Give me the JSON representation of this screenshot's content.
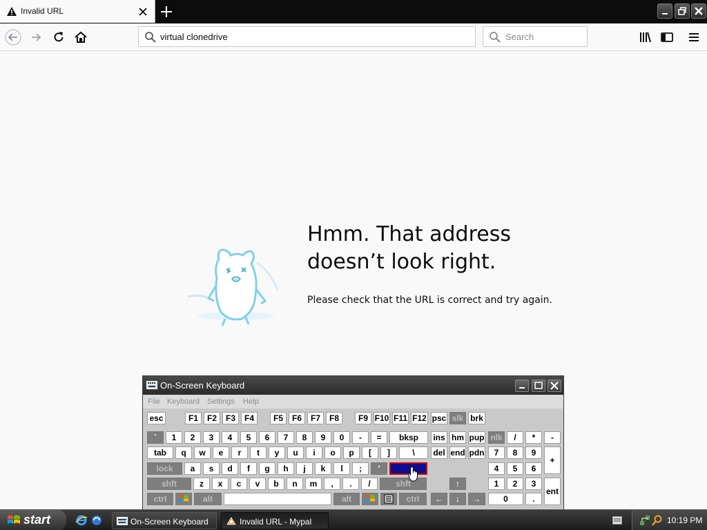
{
  "browser": {
    "tab_title": "Invalid URL",
    "url_value": "virtual clonedrive",
    "search_placeholder": "Search"
  },
  "error_page": {
    "title_line1": "Hmm. That address",
    "title_line2": "doesn’t look right.",
    "description": "Please check that the URL is correct and try again."
  },
  "osk": {
    "title": "On-Screen Keyboard",
    "menu": [
      "File",
      "Keyboard",
      "Settings",
      "Help"
    ],
    "keys": [
      "esc",
      "F1",
      "F2",
      "F3",
      "F4",
      "F5",
      "F6",
      "F7",
      "F8",
      "F9",
      "F10",
      "F11",
      "F12",
      "psc",
      "slk",
      "brk",
      "`",
      "1",
      "2",
      "3",
      "4",
      "5",
      "6",
      "7",
      "8",
      "9",
      "0",
      "-",
      "=",
      "bksp",
      "ins",
      "hm",
      "pup",
      "nlk",
      "/",
      "*",
      "-",
      "tab",
      "q",
      "w",
      "e",
      "r",
      "t",
      "y",
      "u",
      "i",
      "o",
      "p",
      "[",
      "]",
      "\\",
      "del",
      "end",
      "pdn",
      "7",
      "8",
      "9",
      "+",
      "lock",
      "a",
      "s",
      "d",
      "f",
      "g",
      "h",
      "j",
      "k",
      "l",
      ";",
      "'",
      "",
      "4",
      "5",
      "6",
      "shft",
      "z",
      "x",
      "c",
      "v",
      "b",
      "n",
      "m",
      ",",
      ".",
      "/",
      "shft",
      "↑",
      "1",
      "2",
      "3",
      "ent",
      "ctrl",
      "",
      "alt",
      "",
      "alt",
      "",
      "",
      "ctrl",
      "←",
      "↓",
      "→",
      "0",
      "."
    ]
  },
  "taskbar": {
    "start_label": "start",
    "items": [
      "On-Screen Keyboard",
      "Invalid URL - Mypal"
    ],
    "clock": "10:19 PM"
  },
  "colors": {
    "key_highlight": "#0d0d8f",
    "key_highlight_border": "#d00000",
    "page_bg": "#f9f9fa"
  }
}
